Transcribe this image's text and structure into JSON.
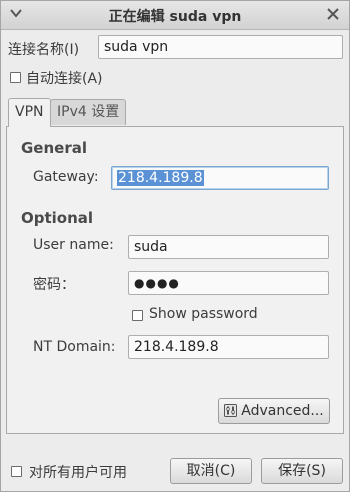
{
  "window": {
    "title": "正在编辑 suda vpn"
  },
  "connection": {
    "name_label": "连接名称(I)",
    "name_value": "suda vpn",
    "autoconnect_label": "自动连接(A)",
    "autoconnect_checked": false
  },
  "tabs": [
    {
      "label": "VPN",
      "active": true
    },
    {
      "label": "IPv4 设置",
      "active": false
    }
  ],
  "vpn": {
    "general_heading": "General",
    "gateway_label": "Gateway:",
    "gateway_value": "218.4.189.8",
    "optional_heading": "Optional",
    "username_label": "User name:",
    "username_value": "suda",
    "password_label": "密码：",
    "password_value": "●●●●",
    "show_password_label": "Show password",
    "show_password_checked": false,
    "ntdomain_label": "NT Domain:",
    "ntdomain_value": "218.4.189.8",
    "advanced_label": "Advanced..."
  },
  "footer": {
    "all_users_label": "对所有用户可用",
    "all_users_checked": false,
    "cancel_label": "取消(C)",
    "save_label": "保存(S)"
  },
  "colors": {
    "selection": "#5b92d6",
    "focus_border": "#7aa5cf"
  },
  "icons": [
    "window-menu-icon",
    "close-icon",
    "advanced-settings-icon"
  ]
}
